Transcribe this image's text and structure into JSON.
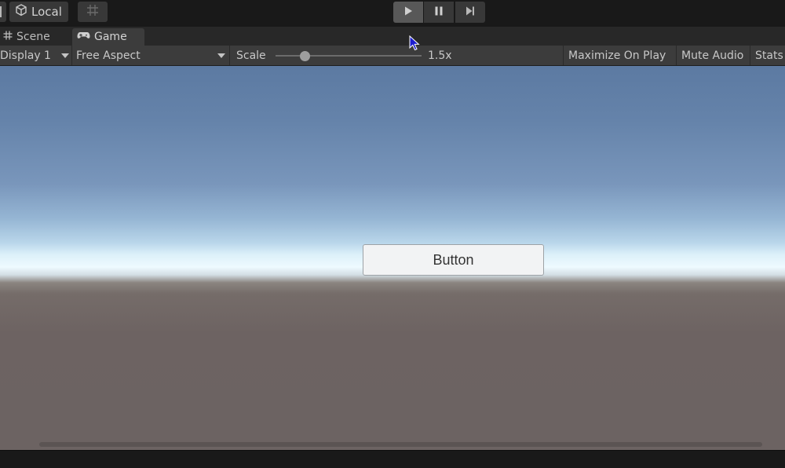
{
  "toolbar": {
    "pivot_icon": "pivot-toggle-icon",
    "handle_label": "Local",
    "handle_icon": "cube-icon",
    "snap_icon": "grid-snap-icon",
    "play_icon": "play-icon",
    "pause_icon": "pause-icon",
    "step_icon": "step-icon"
  },
  "tabs": [
    {
      "label": "Scene",
      "icon": "hash-grid-icon",
      "active": false
    },
    {
      "label": "Game",
      "icon": "gamepad-icon",
      "active": true
    }
  ],
  "game_bar": {
    "display": "Display 1",
    "aspect": "Free Aspect",
    "scale_label": "Scale",
    "scale_value": "1.5x",
    "scale_fraction": 0.2,
    "maximize": "Maximize On Play",
    "mute": "Mute Audio",
    "stats": "Stats"
  },
  "game_view": {
    "button_label": "Button"
  },
  "colors": {
    "editor_bg": "#191919",
    "panel_bg": "#3c3c3c",
    "play_active": "#585858",
    "sky_top": "#5c7aa2",
    "horizon": "#eefaff",
    "ground": "#6c6362"
  }
}
